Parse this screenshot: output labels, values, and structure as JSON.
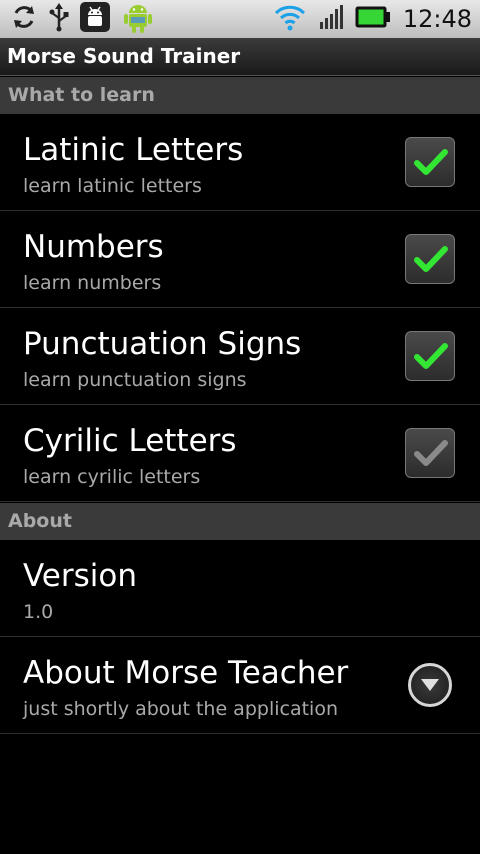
{
  "status_bar": {
    "time": "12:48",
    "icons_left": [
      "sync-icon",
      "usb-icon",
      "android-debug-icon",
      "android-robot-icon"
    ],
    "icons_right": [
      "wifi-icon",
      "signal-icon",
      "battery-icon"
    ]
  },
  "title_bar": {
    "title": "Morse Sound Trainer"
  },
  "sections": [
    {
      "header": "What to learn",
      "items": [
        {
          "title": "Latinic Letters",
          "summary": "learn latinic letters",
          "control": "checkbox",
          "checked": true,
          "enabled": true
        },
        {
          "title": "Numbers",
          "summary": "learn numbers",
          "control": "checkbox",
          "checked": true,
          "enabled": true
        },
        {
          "title": "Punctuation Signs",
          "summary": "learn punctuation signs",
          "control": "checkbox",
          "checked": true,
          "enabled": true
        },
        {
          "title": "Cyrilic Letters",
          "summary": "learn cyrilic letters",
          "control": "checkbox",
          "checked": true,
          "enabled": false
        }
      ]
    },
    {
      "header": "About",
      "items": [
        {
          "title": "Version",
          "summary": "1.0",
          "control": "none"
        },
        {
          "title": "About Morse Teacher",
          "summary": "just shortly about the application",
          "control": "dropdown"
        }
      ]
    }
  ],
  "colors": {
    "check_active": "#33e633",
    "check_disabled": "#8a8a8a",
    "section_bg": "#3a3a3a",
    "section_text": "#a9a9a9"
  }
}
